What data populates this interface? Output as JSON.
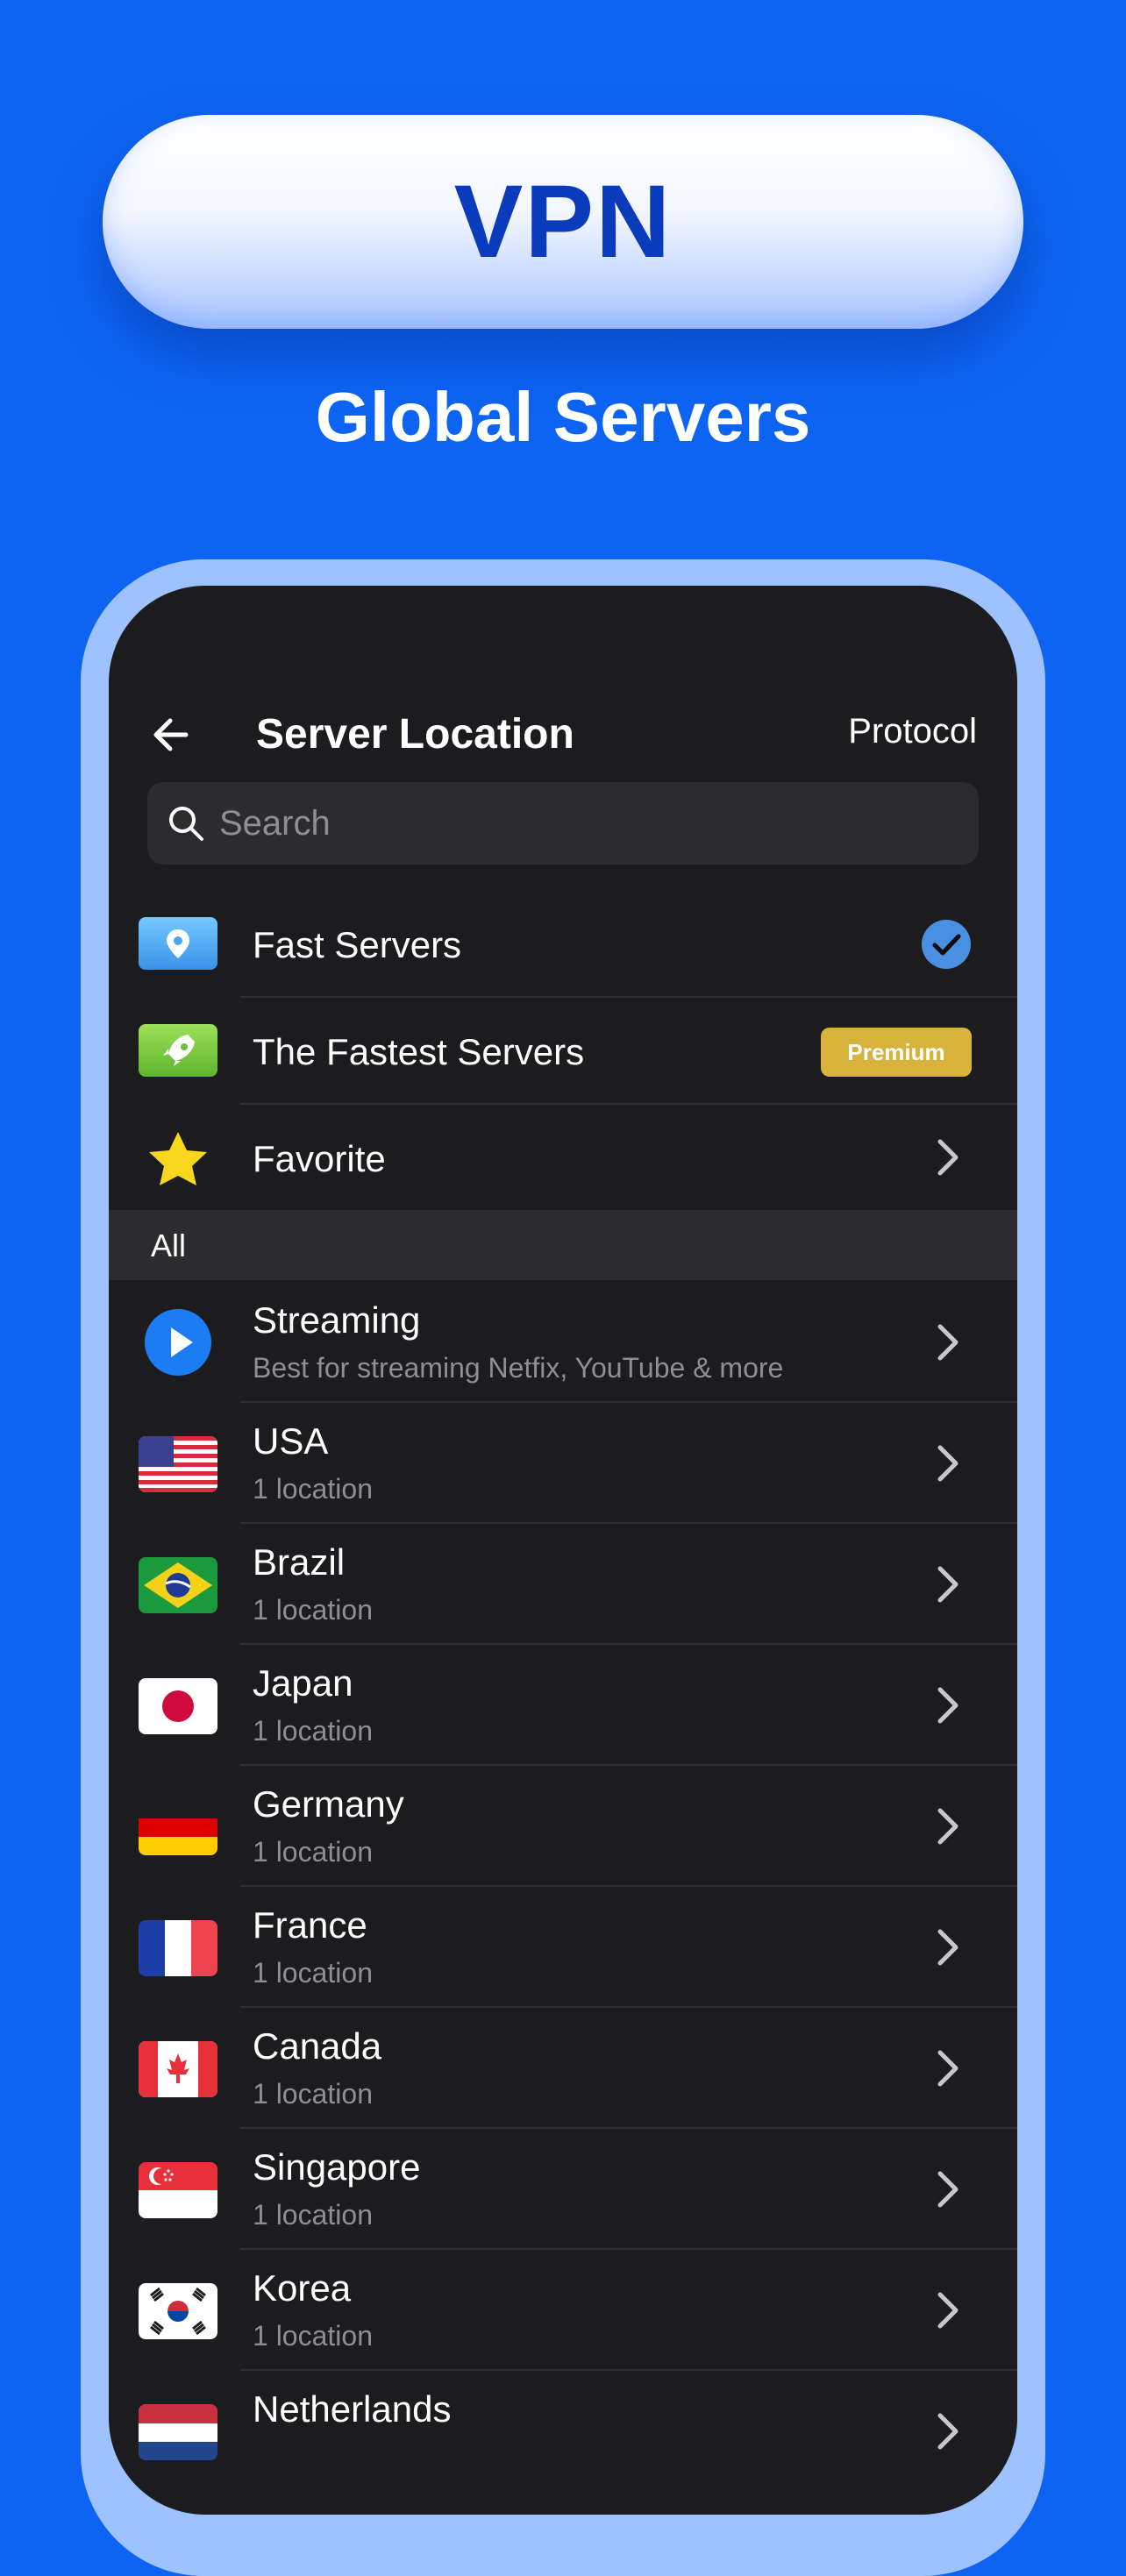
{
  "banner": {
    "pill_text": "VPN",
    "tagline": "Global Servers"
  },
  "header": {
    "title": "Server Location",
    "protocol_label": "Protocol"
  },
  "search": {
    "placeholder": "Search"
  },
  "quick": [
    {
      "label": "Fast Servers",
      "icon": "location-pin-icon",
      "selected": true
    },
    {
      "label": "The Fastest Servers",
      "icon": "rocket-icon",
      "badge": "Premium"
    },
    {
      "label": "Favorite",
      "icon": "star-icon"
    }
  ],
  "section": {
    "label": "All"
  },
  "servers": [
    {
      "name": "Streaming",
      "sub": "Best for streaming Netfix, YouTube & more",
      "icon": "play-icon"
    },
    {
      "name": "USA",
      "sub": "1 location",
      "icon": "flag-usa-icon"
    },
    {
      "name": "Brazil",
      "sub": "1 location",
      "icon": "flag-brazil-icon"
    },
    {
      "name": "Japan",
      "sub": "1 location",
      "icon": "flag-japan-icon"
    },
    {
      "name": "Germany",
      "sub": "1 location",
      "icon": "flag-germany-icon"
    },
    {
      "name": "France",
      "sub": "1 location",
      "icon": "flag-france-icon"
    },
    {
      "name": "Canada",
      "sub": "1 location",
      "icon": "flag-canada-icon"
    },
    {
      "name": "Singapore",
      "sub": "1 location",
      "icon": "flag-singapore-icon"
    },
    {
      "name": "Korea",
      "sub": "1 location",
      "icon": "flag-korea-icon"
    },
    {
      "name": "Netherlands",
      "sub": "",
      "icon": "flag-netherlands-icon"
    }
  ],
  "colors": {
    "background": "#0d64f2",
    "pill_text": "#0b3bbd",
    "screen": "#1c1c1e",
    "check": "#4a90e2",
    "premium": "#d8b33c"
  }
}
